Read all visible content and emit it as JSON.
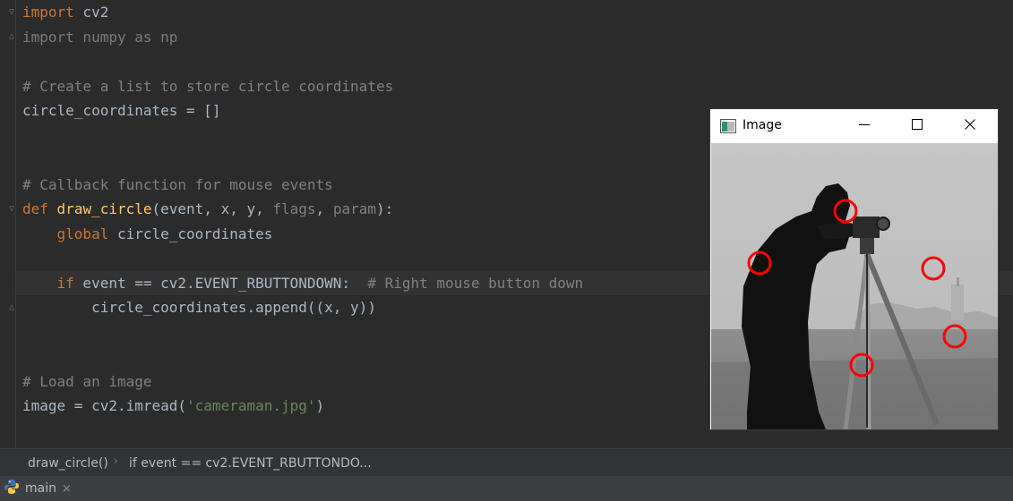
{
  "editor": {
    "lines": {
      "l1": {
        "kw": "import",
        "rest": " cv2"
      },
      "l2": {
        "text": "import numpy as np"
      },
      "l4": {
        "comment": "# Create a list to store circle coordinates"
      },
      "l5": {
        "text": "circle_coordinates = []"
      },
      "l8": {
        "comment": "# Callback function for mouse events"
      },
      "l9": {
        "kw": "def",
        "fn": "draw_circle",
        "open": "(event, x, y, ",
        "p1": "flags",
        "comma": ", ",
        "p2": "param",
        "close": "):"
      },
      "l10": {
        "kw": "global",
        "rest": " circle_coordinates"
      },
      "l12": {
        "kw": "if",
        "rest": " event == cv2.EVENT_RBUTTONDOWN:  ",
        "comment": "# Right mouse button down"
      },
      "l13": {
        "text": "circle_coordinates.append((x, y))"
      },
      "l16": {
        "comment": "# Load an image"
      },
      "l17": {
        "pre": "image = cv2.imread(",
        "str": "'cameraman.jpg'",
        "post": ")"
      }
    }
  },
  "breadcrumb": {
    "item1": "draw_circle()",
    "sep": "›",
    "item2": "if event == cv2.EVENT_RBUTTONDO..."
  },
  "run": {
    "tab_label": "main",
    "close": "×"
  },
  "image_window": {
    "title": "Image",
    "circle_color": "#ff0000"
  },
  "colors": {
    "editor_bg": "#2b2b2b",
    "keyword": "#cc7832",
    "function": "#ffc66d",
    "comment": "#808080",
    "string": "#6a8759",
    "text": "#a9b7c6"
  }
}
